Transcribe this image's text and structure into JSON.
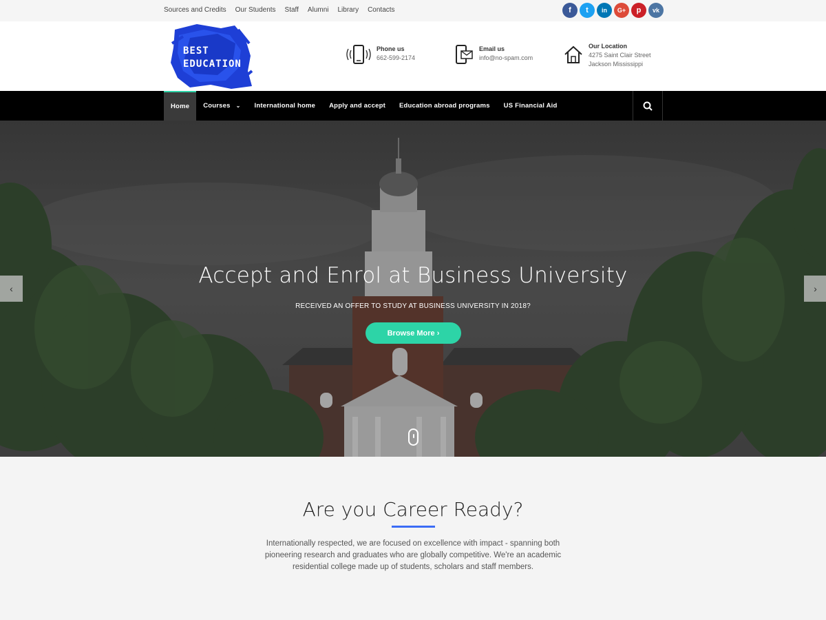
{
  "topbar": {
    "links": [
      "Sources and Credits",
      "Our Students",
      "Staff",
      "Alumni",
      "Library",
      "Contacts"
    ],
    "social": [
      {
        "icon": "facebook-icon",
        "glyph": "f",
        "color": "#3b5998"
      },
      {
        "icon": "twitter-icon",
        "glyph": "t",
        "color": "#1da1f2"
      },
      {
        "icon": "linkedin-icon",
        "glyph": "in",
        "color": "#0077b5"
      },
      {
        "icon": "google-plus-icon",
        "glyph": "G+",
        "color": "#dd4b39"
      },
      {
        "icon": "pinterest-icon",
        "glyph": "p",
        "color": "#cb2027"
      },
      {
        "icon": "vk-icon",
        "glyph": "vk",
        "color": "#4c75a3"
      }
    ]
  },
  "header": {
    "logo_line1": "BEST",
    "logo_line2": "EDUCATION",
    "phone": {
      "title": "Phone us",
      "line1": "662-599-2174"
    },
    "email": {
      "title": "Email us",
      "line1": "info@no-spam.com"
    },
    "location": {
      "title": "Our Location",
      "line1": "4275 Saint Clair Street",
      "line2": "Jackson Mississippi"
    }
  },
  "nav": {
    "items": [
      "Home",
      "Courses",
      "International home",
      "Apply and accept",
      "Education abroad programs",
      "US Financial Aid"
    ],
    "chevron": "⌄"
  },
  "hero": {
    "title": "Accept and Enrol at Business University",
    "subtitle": "RECEIVED AN OFFER TO STUDY AT BUSINESS UNIVERSITY IN 2018?",
    "button": "Browse More ›",
    "prev": "‹",
    "next": "›"
  },
  "section": {
    "title": "Are you Career Ready?",
    "text": "Internationally respected, we are focused on excellence with impact - spanning both pioneering research and graduates who are globally competitive. We're an academic residential college made up of students, scholars and staff members."
  },
  "colors": {
    "accent": "#2dd4a7",
    "underline": "#3b6cf6",
    "nav_bg": "#000000"
  }
}
